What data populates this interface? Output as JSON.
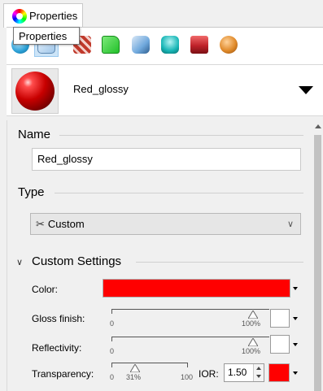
{
  "panel": {
    "tab_label": "Properties",
    "tooltip": "Properties"
  },
  "toolbar": {
    "buttons": [
      {
        "icon": "object-properties-icon",
        "color": "#2aa0d6"
      },
      {
        "icon": "material-icon",
        "color": "#9fc5e8"
      },
      {
        "icon": "texture-mapping-icon",
        "color": "#c0392b"
      },
      {
        "icon": "decal-icon",
        "color": "#22c02a"
      },
      {
        "icon": "light-icon",
        "color": "#6fa8dc"
      },
      {
        "icon": "environment-icon",
        "color": "#17b6b6"
      },
      {
        "icon": "render-icon",
        "color": "#c0222a"
      },
      {
        "icon": "ground-plane-icon",
        "color": "#e08a2a"
      }
    ]
  },
  "material": {
    "name": "Red_glossy"
  },
  "sections": {
    "name_label": "Name",
    "name_value": "Red_glossy",
    "type_label": "Type",
    "type_value": "Custom",
    "custom_settings_label": "Custom Settings"
  },
  "settings": {
    "color_label": "Color:",
    "color_value": "#ff0000",
    "gloss_label": "Gloss finish:",
    "gloss_min": "0",
    "gloss_value": "100%",
    "gloss_fraction": 1.0,
    "reflectivity_label": "Reflectivity:",
    "reflectivity_min": "0",
    "reflectivity_value": "100%",
    "reflectivity_fraction": 1.0,
    "transparency_label": "Transparency:",
    "transparency_min": "0",
    "transparency_value": "31%",
    "transparency_max": "100",
    "transparency_fraction": 0.31,
    "ior_label": "IOR:",
    "ior_value": "1.50",
    "transparency_color": "#ff0000"
  }
}
